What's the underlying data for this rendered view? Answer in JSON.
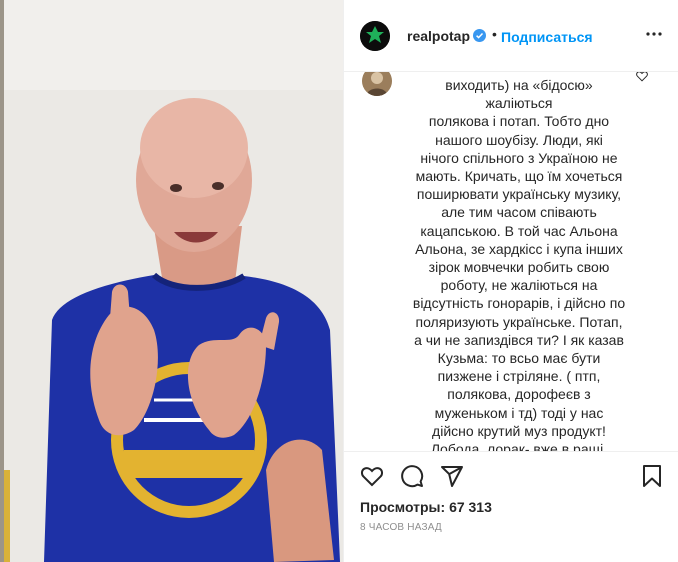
{
  "post": {
    "username": "realpotap",
    "follow_label": "Подписаться",
    "separator": "•",
    "verified_icon": "verified-badge-icon",
    "more_icon": "more-options-icon"
  },
  "comment": {
    "text": "виходить) на «бідосю» жаліються\nполякова і потап. Тобто дно\nнашого шоубізу. Люди, які\nнічого спільного з Україною не\nмають. Кричать, що їм хочеться\nпоширювати українську музику,\nале тим часом співають\nкацапською. В той час Альона\nАльона, зе хардкісс і купа інших\nзірок мовчечки робить свою\nроботу, не жаліються на\nвідсутність гонорарів, і дійсно по\nполяризують українське. Потап,\nа чи не запиздівся ти? І як казав\nКузьма: то всьо має бути\nпизжене і стріляне. ( птп,\nполякова, дорофеєв з\nмуженьком і тд) тоді у нас\nдійсно крутий муз продукт!\nЛобода, лорак- вже в ращі.\nПотап, не затягуй. Краще живим"
  },
  "actions": {
    "like_icon": "heart-icon",
    "comment_icon": "comment-icon",
    "share_icon": "share-icon",
    "save_icon": "bookmark-icon"
  },
  "stats": {
    "views_label": "Просмотры:",
    "views_count": "67 313",
    "timestamp": "8 ЧАСОВ НАЗАД"
  },
  "colors": {
    "accent": "#0095f6",
    "text": "#262626",
    "muted": "#8e8e8e",
    "shirt": "#1d2fa0"
  }
}
